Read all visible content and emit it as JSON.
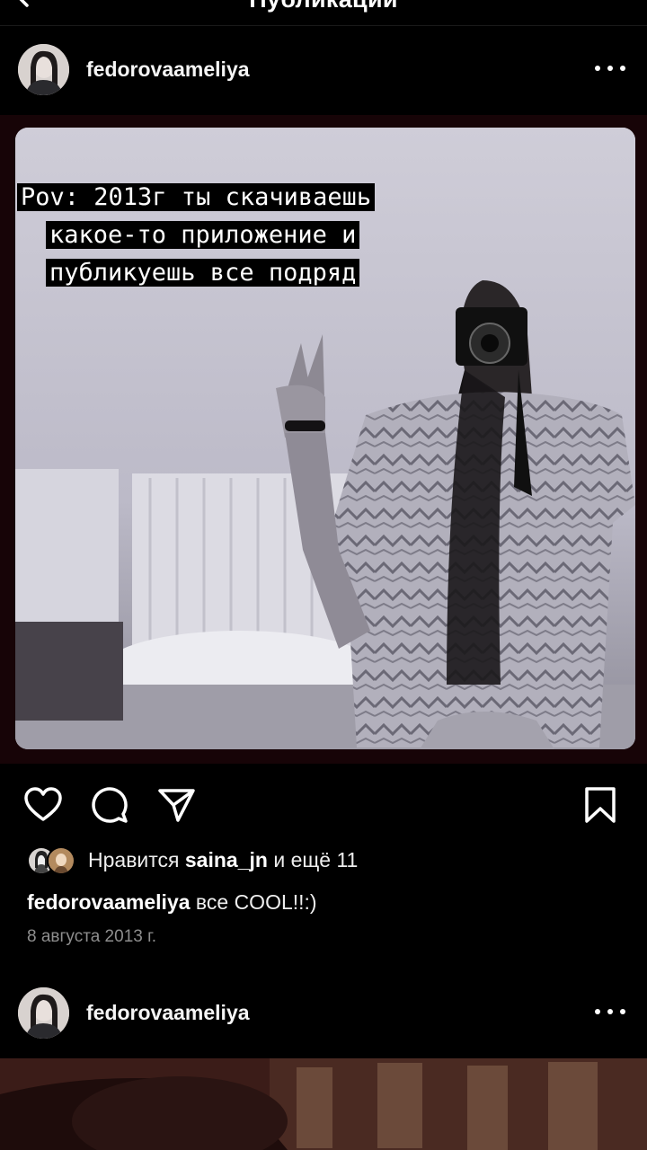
{
  "header": {
    "title": "Публикации",
    "back_icon": "chevron-left-icon"
  },
  "post": {
    "username": "fedorovaameliya",
    "overlay_lines": [
      "Pov: 2013г ты скачиваешь",
      "какое-то приложение и",
      "публикуешь все подряд"
    ],
    "likes": {
      "prefix": "Нравится",
      "user": "saina_jn",
      "suffix": "и ещё 11"
    },
    "caption": {
      "username": "fedorovaameliya",
      "text": "все COOL!!:)"
    },
    "date": "8 августа 2013 г.",
    "icons": [
      "heart-icon",
      "comment-icon",
      "share-icon",
      "bookmark-icon",
      "more-icon"
    ]
  },
  "next_post": {
    "username": "fedorovaameliya"
  },
  "colors": {
    "background": "#000000",
    "secondary_text": "#8e8e8e",
    "frame": "#170407"
  }
}
